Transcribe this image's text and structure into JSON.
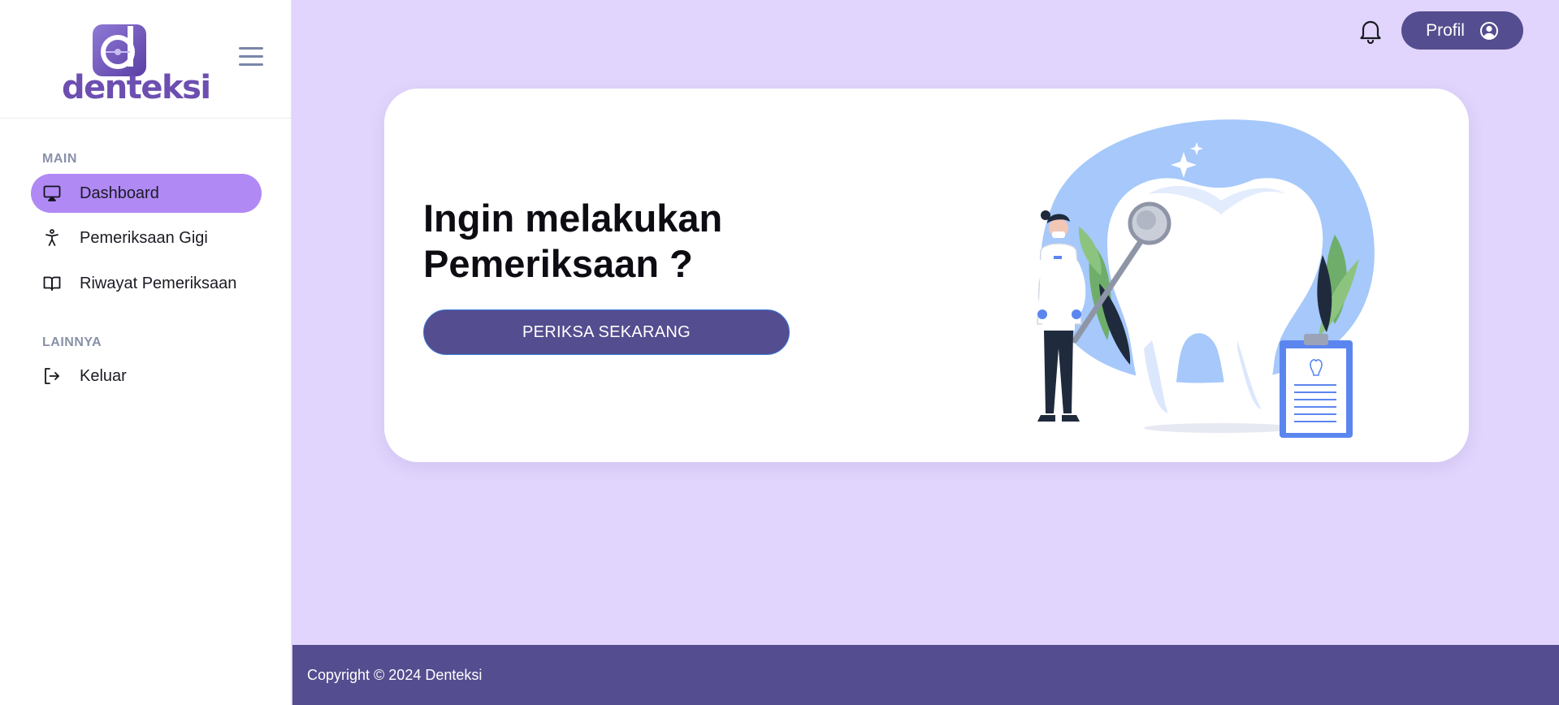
{
  "brand": {
    "name": "denteksi",
    "logo_icon": "denteksi-logo-icon"
  },
  "sidebar": {
    "sections": [
      {
        "label": "MAIN"
      },
      {
        "label": "LAINNYA"
      }
    ],
    "items": [
      {
        "label": "Dashboard",
        "icon": "monitor-icon",
        "active": true
      },
      {
        "label": "Pemeriksaan Gigi",
        "icon": "accessibility-person-icon"
      },
      {
        "label": "Riwayat Pemeriksaan",
        "icon": "open-book-icon"
      },
      {
        "label": "Keluar",
        "icon": "logout-icon"
      }
    ]
  },
  "header": {
    "notification_icon": "bell-icon",
    "profile_label": "Profil",
    "profile_icon": "user-circle-icon"
  },
  "hero": {
    "headline": "Ingin melakukan Pemeriksaan ?",
    "cta_label": "PERIKSA SEKARANG",
    "illustration": "dentist-with-tooth-illustration"
  },
  "footer": {
    "copyright": "Copyright © 2024 Denteksi"
  },
  "colors": {
    "background": "#e1d5fd",
    "primary": "#544d8f",
    "active_nav": "#b089f5",
    "illustration_blue": "#a6c8fb"
  }
}
